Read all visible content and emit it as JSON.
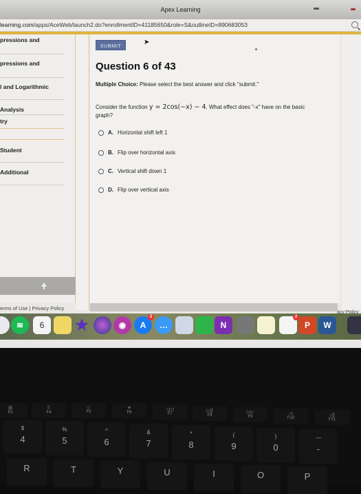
{
  "window": {
    "title": "Apex Learning",
    "url_host": "learning.com",
    "url_path": "/apps/AceWeb/launch2.do?enrollmentID=41185650&role=S&outlineID=890683053"
  },
  "sidebar": {
    "items": [
      {
        "label": "pressions and"
      },
      {
        "label": "pressions and"
      },
      {
        "label": "l and Logarithmic"
      },
      {
        "label": "Analysis"
      },
      {
        "label": "try"
      },
      {
        "label": "Student"
      },
      {
        "label": "Additional"
      }
    ],
    "footer_links": "erms of Use  |  Privacy Policy"
  },
  "main": {
    "submit_label": "SUBMIT",
    "question_title": "Question 6 of 43",
    "question_type_label": "Multiple Choice:",
    "question_type_text": " Please select the best answer and click \"submit.\"",
    "prompt_before": "Consider the function ",
    "prompt_math": "y = 2cos(−x) − 4",
    "prompt_after": ". What effect does \"-x\" have on the basic graph?",
    "options": [
      {
        "letter": "A.",
        "text": "Horizontal shift left 1"
      },
      {
        "letter": "B.",
        "text": "Flip over horizontal axis"
      },
      {
        "letter": "C.",
        "text": "Vertical shift down 1"
      },
      {
        "letter": "D.",
        "text": "Flip over vertical axis"
      }
    ]
  },
  "right_pane": {
    "policy_text": "acy Policy"
  },
  "dock": {
    "calendar_day": "6",
    "app_store_badge": "2",
    "reminders_badge": "2",
    "apps": [
      "itunes",
      "spotify",
      "calendar",
      "stickies",
      "imovie",
      "siri",
      "photo-booth",
      "app-store",
      "messages",
      "preview",
      "evernote",
      "onenote",
      "calculator",
      "notes",
      "reminders",
      "powerpoint",
      "word",
      "finder-window"
    ]
  },
  "keyboard": {
    "fkeys": [
      {
        "glyph": "⊞",
        "label": "F3"
      },
      {
        "glyph": "⠿",
        "label": "F4"
      },
      {
        "glyph": "☼",
        "label": "F5"
      },
      {
        "glyph": "☀",
        "label": "F6"
      },
      {
        "glyph": "◁◁",
        "label": "F7"
      },
      {
        "glyph": "▷||",
        "label": "F8"
      },
      {
        "glyph": "▷▷",
        "label": "F9"
      },
      {
        "glyph": "◁",
        "label": "F10"
      },
      {
        "glyph": "◁)",
        "label": "F11"
      }
    ],
    "number_keys": [
      {
        "sym": "$",
        "num": "4"
      },
      {
        "sym": "%",
        "num": "5"
      },
      {
        "sym": "^",
        "num": "6"
      },
      {
        "sym": "&",
        "num": "7"
      },
      {
        "sym": "*",
        "num": "8"
      },
      {
        "sym": "(",
        "num": "9"
      },
      {
        "sym": ")",
        "num": "0"
      },
      {
        "sym": "—",
        "num": "-"
      }
    ],
    "letter_keys": [
      "R",
      "T",
      "Y",
      "U",
      "I",
      "O",
      "P"
    ]
  }
}
